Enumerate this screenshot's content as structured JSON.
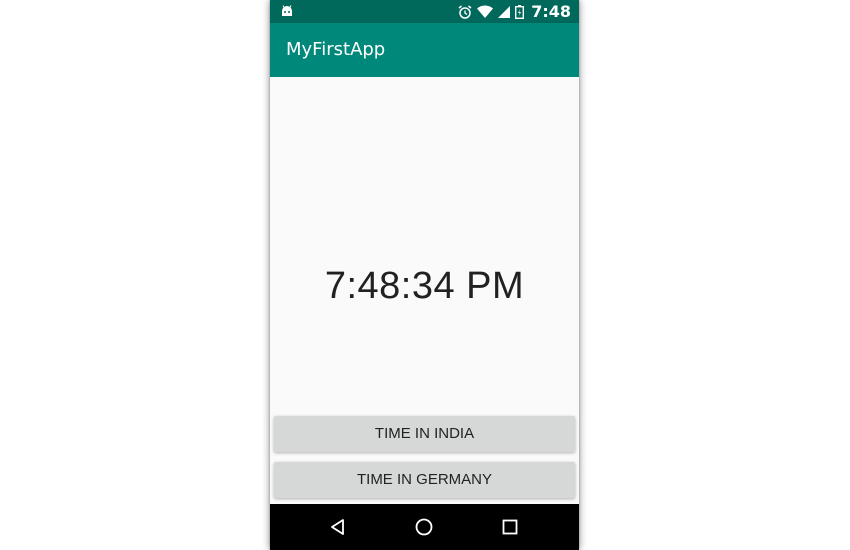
{
  "status_bar": {
    "time": "7:48",
    "icons": [
      "android-icon",
      "alarm-icon",
      "wifi-icon",
      "signal-icon",
      "battery-icon"
    ]
  },
  "app_bar": {
    "title": "MyFirstApp"
  },
  "main": {
    "clock_text": "7:48:34 PM",
    "buttons": [
      {
        "label": "TIME IN INDIA"
      },
      {
        "label": "TIME IN GERMANY"
      }
    ]
  },
  "nav_bar": {
    "icons": [
      "back-icon",
      "home-icon",
      "recents-icon"
    ]
  },
  "colors": {
    "status_bar": "#00695c",
    "app_bar": "#00897b",
    "button": "#d6d7d7",
    "background": "#fafafa",
    "nav_bar": "#000000"
  }
}
